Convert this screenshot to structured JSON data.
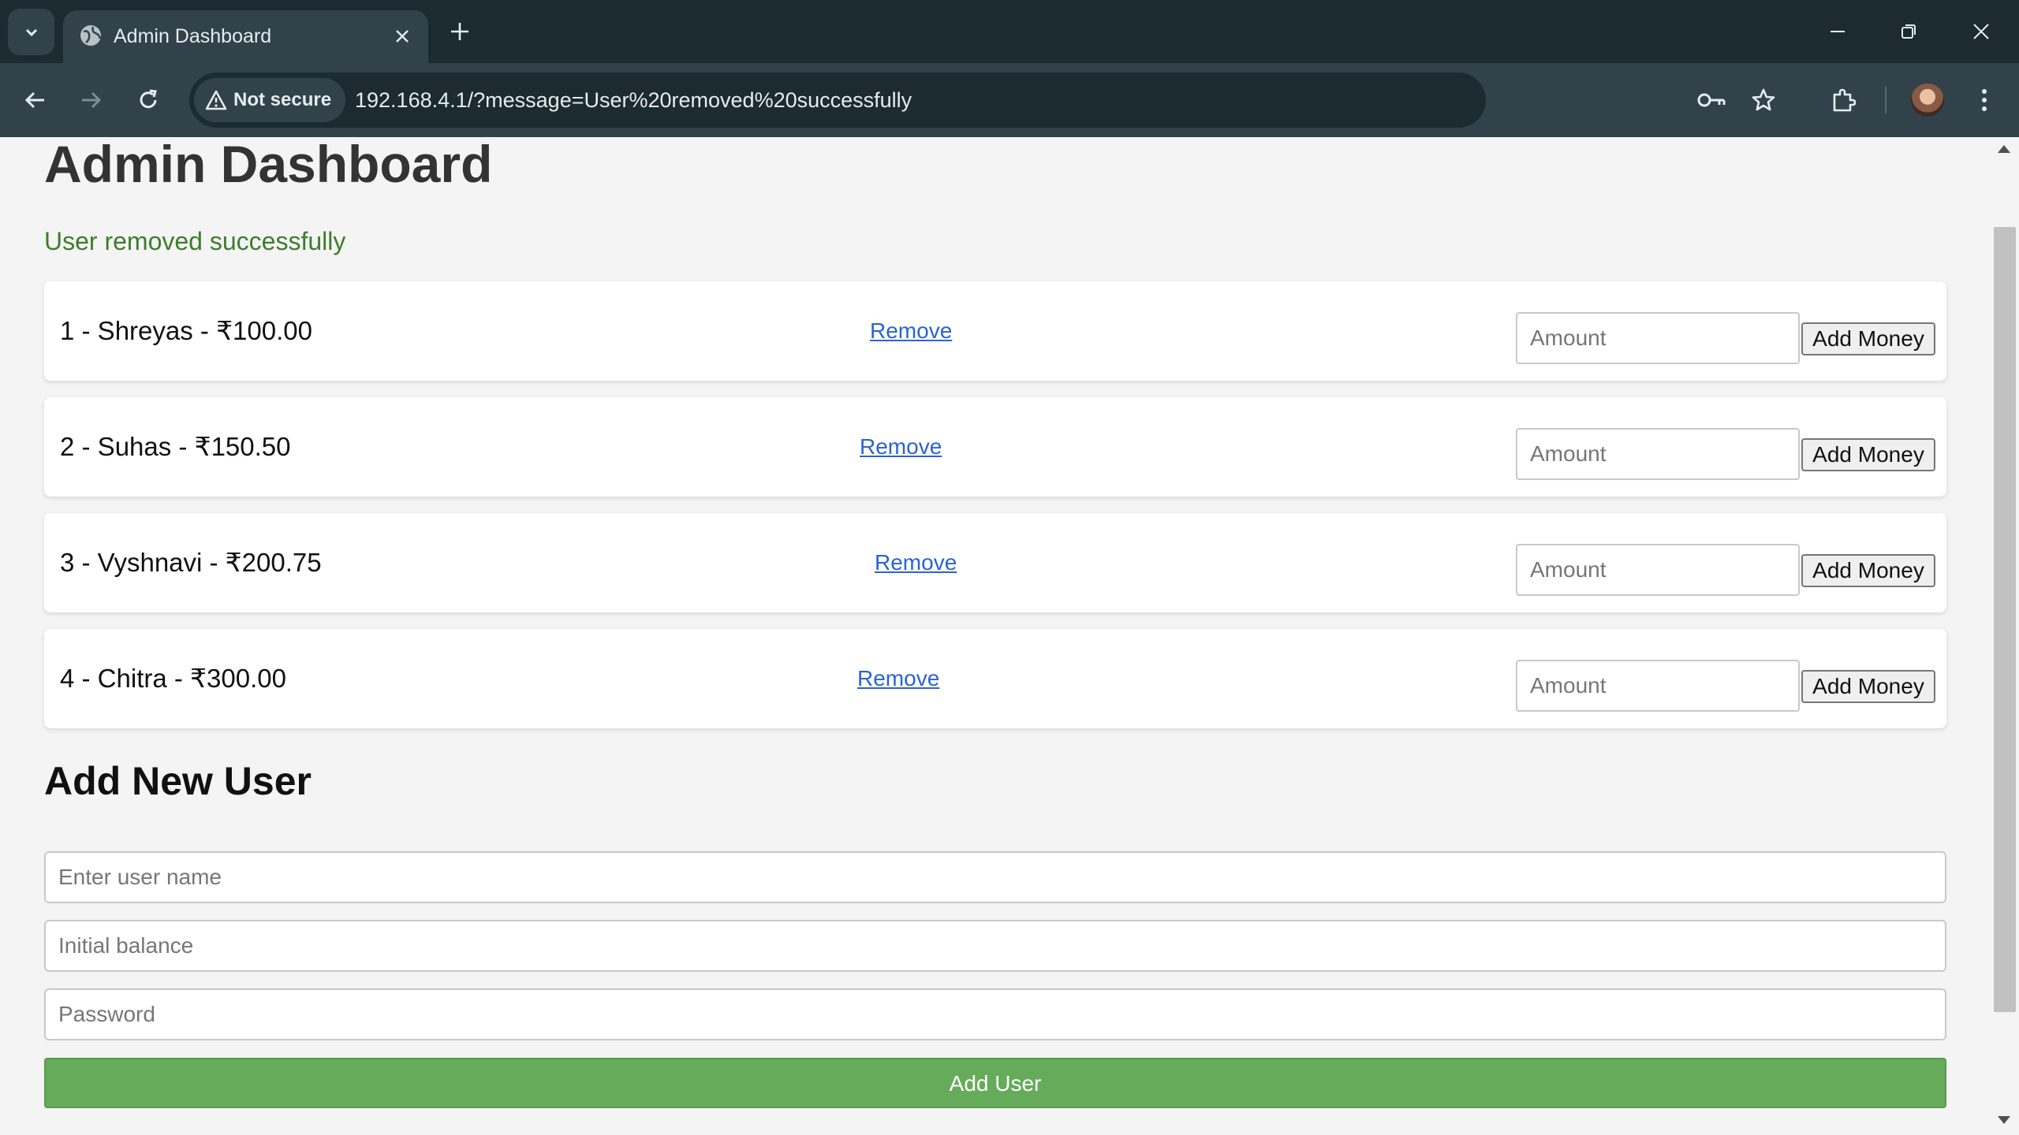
{
  "browser": {
    "tab_title": "Admin Dashboard",
    "security_label": "Not secure",
    "url": "192.168.4.1/?message=User%20removed%20successfully"
  },
  "page": {
    "title": "Admin Dashboard",
    "message": "User removed successfully",
    "message_color": "#3e7d2a"
  },
  "users": [
    {
      "label": "1 - Shreyas - ₹100.00",
      "remove_label": "Remove",
      "amount_placeholder": "Amount",
      "add_money_label": "Add Money"
    },
    {
      "label": "2 - Suhas - ₹150.50",
      "remove_label": "Remove",
      "amount_placeholder": "Amount",
      "add_money_label": "Add Money"
    },
    {
      "label": "3 - Vyshnavi - ₹200.75",
      "remove_label": "Remove",
      "amount_placeholder": "Amount",
      "add_money_label": "Add Money"
    },
    {
      "label": "4 - Chitra - ₹300.00",
      "remove_label": "Remove",
      "amount_placeholder": "Amount",
      "add_money_label": "Add Money"
    }
  ],
  "add_user": {
    "heading": "Add New User",
    "name_placeholder": "Enter user name",
    "balance_placeholder": "Initial balance",
    "password_placeholder": "Password",
    "submit_label": "Add User",
    "accent_color": "#66ab5a"
  }
}
